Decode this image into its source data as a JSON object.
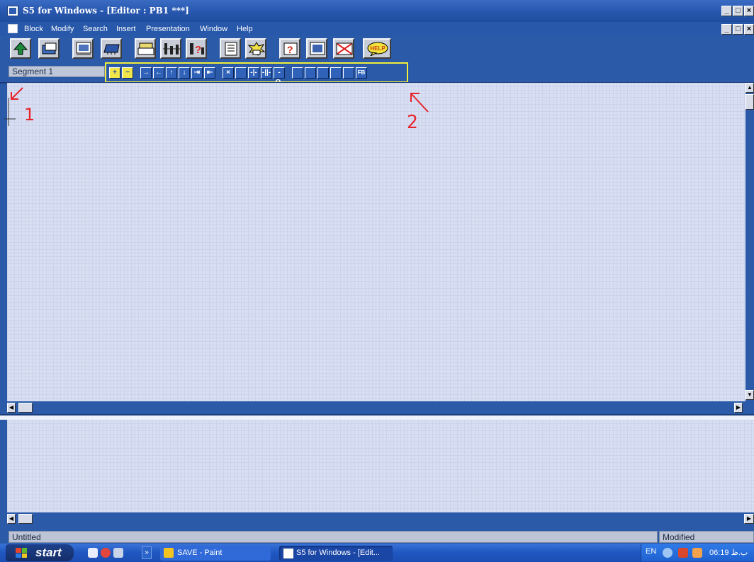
{
  "window": {
    "title": "S5 for Windows - [Editor : PB1 ***]",
    "controls": [
      "_",
      "□",
      "×"
    ]
  },
  "menu": [
    "Block",
    "Modify",
    "Search",
    "Insert",
    "Presentation",
    "Window",
    "Help"
  ],
  "toolbar": {
    "tools": [
      "upload-icon",
      "open-block-icon",
      "monitor-icon",
      "plc-icon",
      "module-icon",
      "ladder-icon",
      "cross-reference-icon",
      "listing-icon",
      "flash-icon",
      "diagnostics-icon",
      "display-icon",
      "delete-icon",
      "help-icon"
    ],
    "help_label": "HELP"
  },
  "segment": {
    "label": "Segment 1"
  },
  "ladder_toolbar": {
    "buttons": [
      "+",
      "−",
      "→",
      "←",
      "↑",
      "↓",
      "⇥",
      "⇤",
      "×",
      "",
      "-|-",
      "-||-",
      "-O-",
      "",
      "",
      "",
      "",
      "",
      "FB"
    ],
    "highlight_color": "#f2ef3a"
  },
  "annotations": {
    "mark1": "1",
    "mark2": "2",
    "color": "#e8242a"
  },
  "status": {
    "left": "Untitled",
    "right": "Modified"
  },
  "taskbar": {
    "start_label": "start",
    "tasks": [
      "SAVE - Paint",
      "S5 for Windows - [Edit..."
    ],
    "tray_language": "EN",
    "clock": "06:19 ب.ظ"
  }
}
